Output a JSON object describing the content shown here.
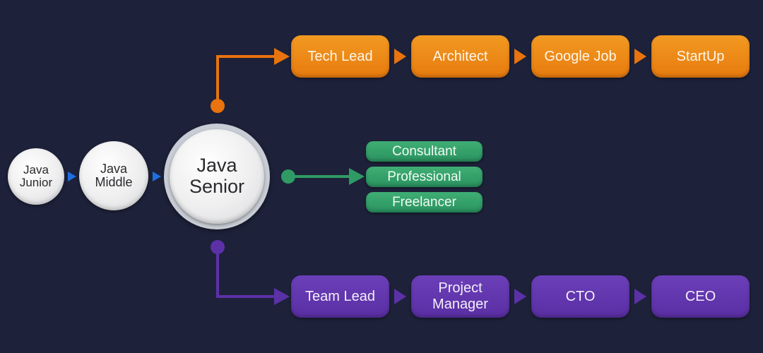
{
  "colors": {
    "background": "#1d2139",
    "orange": "#ec820f",
    "green": "#31a067",
    "purple": "#5f32a8",
    "blue_arrow": "#1f6fe0",
    "circle_fill": "#eeeeef"
  },
  "start_nodes": [
    {
      "line1": "Java",
      "line2": "Junior"
    },
    {
      "line1": "Java",
      "line2": "Middle"
    },
    {
      "line1": "Java",
      "line2": "Senior"
    }
  ],
  "technical_track": {
    "color": "orange",
    "steps": [
      "Tech Lead",
      "Architect",
      "Google Job",
      "StartUp"
    ]
  },
  "expert_track": {
    "color": "green",
    "options": [
      "Consultant",
      "Professional",
      "Freelancer"
    ]
  },
  "management_track": {
    "color": "purple",
    "steps": [
      {
        "line1": "Team Lead",
        "line2": ""
      },
      {
        "line1": "Project",
        "line2": "Manager"
      },
      {
        "line1": "CTO",
        "line2": ""
      },
      {
        "line1": "CEO",
        "line2": ""
      }
    ]
  }
}
